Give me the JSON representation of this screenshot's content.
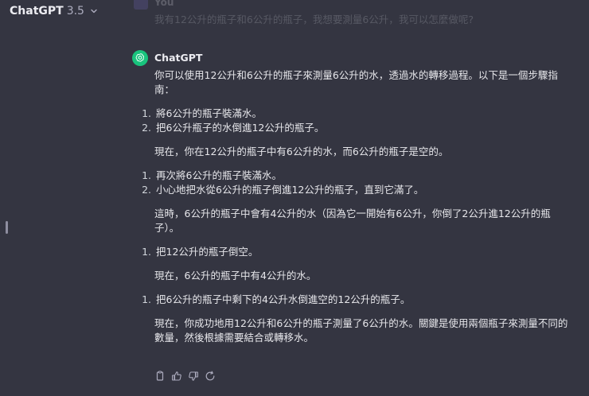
{
  "header": {
    "model_name": "ChatGPT",
    "model_version": "3.5"
  },
  "previous_message": {
    "author": "You",
    "text": "我有12公升的瓶子和6公升的瓶子，我想要測量6公升，我可以怎麼做呢?"
  },
  "assistant_message": {
    "author": "ChatGPT",
    "intro": "你可以使用12公升和6公升的瓶子來測量6公升的水，透過水的轉移過程。以下是一個步驟指南：",
    "steps_1": [
      {
        "num": "1.",
        "text": "將6公升的瓶子裝滿水。"
      },
      {
        "num": "2.",
        "text": "把6公升瓶子的水倒進12公升的瓶子。"
      }
    ],
    "note_1": "現在，你在12公升的瓶子中有6公升的水，而6公升的瓶子是空的。",
    "steps_2": [
      {
        "num": "1.",
        "text": "再次將6公升的瓶子裝滿水。"
      },
      {
        "num": "2.",
        "text": "小心地把水從6公升的瓶子倒進12公升的瓶子，直到它滿了。"
      }
    ],
    "note_2": "這時，6公升的瓶子中會有4公升的水（因為它一開始有6公升，你倒了2公升進12公升的瓶子）。",
    "steps_3": [
      {
        "num": "1.",
        "text": "把12公升的瓶子倒空。"
      }
    ],
    "note_3": "現在，6公升的瓶子中有4公升的水。",
    "steps_4": [
      {
        "num": "1.",
        "text": "把6公升的瓶子中剩下的4公升水倒進空的12公升的瓶子。"
      }
    ],
    "conclusion": "現在，你成功地用12公升和6公升的瓶子測量了6公升的水。關鍵是使用兩個瓶子來測量不同的數量，然後根據需要結合或轉移水。"
  },
  "actions": {
    "icons": [
      "copy-icon",
      "thumbs-up-icon",
      "thumbs-down-icon",
      "regenerate-icon"
    ]
  },
  "colors": {
    "background": "#343541",
    "assistant_avatar": "#19c37d",
    "text": "#ececf1"
  }
}
